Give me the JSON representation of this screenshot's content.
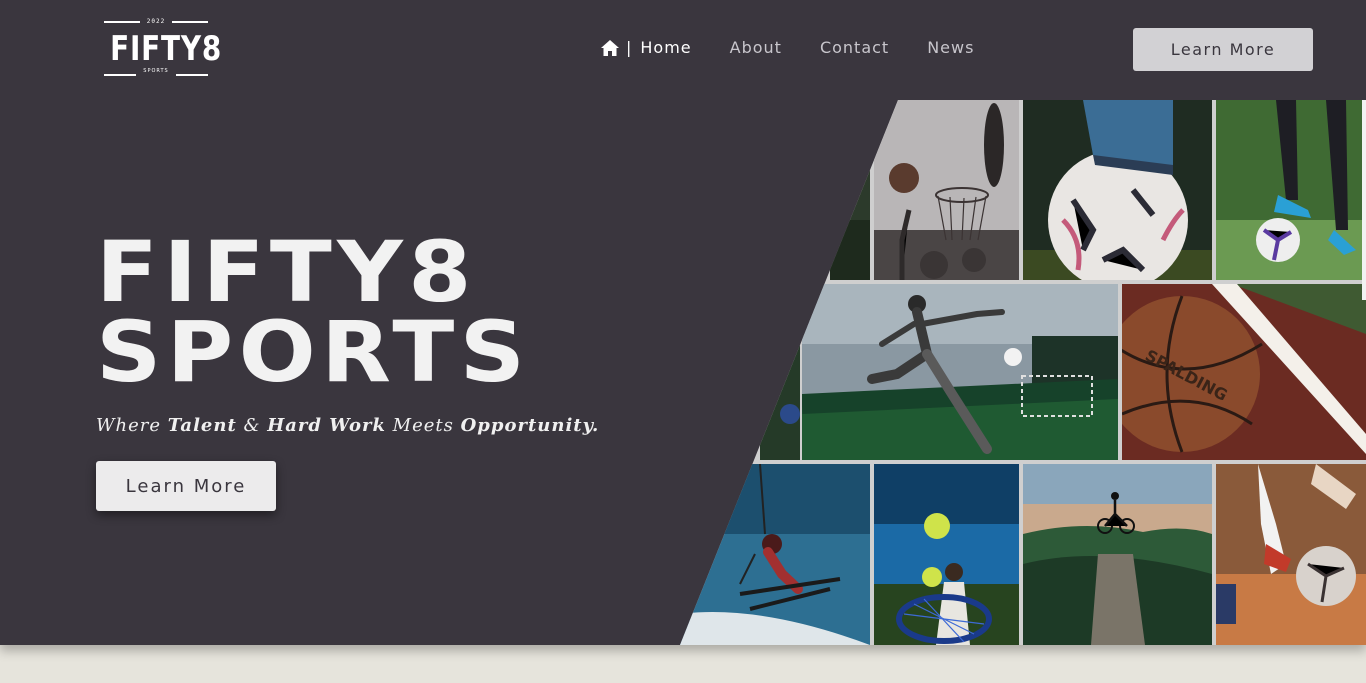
{
  "logo": {
    "year": "2022",
    "brand": "FIFTY8",
    "sub": "SPORTS"
  },
  "nav": {
    "separator": "|",
    "items": [
      {
        "label": "Home"
      },
      {
        "label": "About"
      },
      {
        "label": "Contact"
      },
      {
        "label": "News"
      }
    ]
  },
  "header_button": "Learn More",
  "hero": {
    "title_line1": "FIFTY8",
    "title_line2": "SPORTS",
    "tagline": [
      "Where ",
      "Talent",
      " & ",
      "Hard Work",
      " Meets ",
      "Opportunity."
    ],
    "button": "Learn More"
  },
  "colors": {
    "hero_bg": "#3a363e",
    "page_bg": "#e6e4dc",
    "button_bg": "#d2d1d4",
    "text": "#f2f2f2"
  },
  "collage": [
    {
      "name": "basketball-hoop-photo"
    },
    {
      "name": "soccer-ball-under-foot-photo"
    },
    {
      "name": "soccer-player-legs-photo"
    },
    {
      "name": "soccer-kick-photo"
    },
    {
      "name": "spalding-basketball-photo"
    },
    {
      "name": "skier-jump-photo"
    },
    {
      "name": "tennis-player-photo"
    },
    {
      "name": "mountain-biker-photo"
    },
    {
      "name": "soccer-dribble-photo"
    }
  ]
}
